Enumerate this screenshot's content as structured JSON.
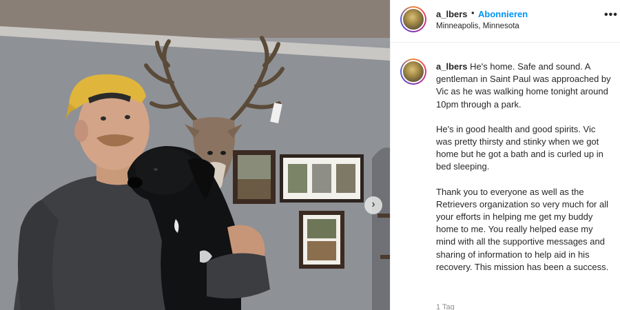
{
  "post": {
    "username": "a_lbers",
    "separator": "•",
    "follow_label": "Abonnieren",
    "location": "Minneapolis, Minnesota",
    "more_label": "•••"
  },
  "caption": {
    "username": "a_lbers",
    "paragraph_1": "He's home. Safe and sound. A gentleman in Saint Paul was approached by Vic as he was walking home tonight around 10pm through a park.",
    "paragraph_2": "He's in good health and good spirits. Vic was pretty thirsty and stinky when we got home but he got a bath and is curled up in bed sleeping.",
    "paragraph_3": "Thank you to everyone as well as the Retrievers organization so very much for all your efforts in helping me get my buddy home to me. You really helped ease my mind with all the supportive messages and sharing of information to help aid in his recovery. This mission has been a success.",
    "time_ago": "1 Tag"
  },
  "carousel": {
    "next_label": "›"
  },
  "icons": [
    "chevron-right-icon",
    "more-icon"
  ],
  "colors": {
    "follow": "#0095f6",
    "text": "#262626",
    "muted": "#8e8e8e"
  }
}
